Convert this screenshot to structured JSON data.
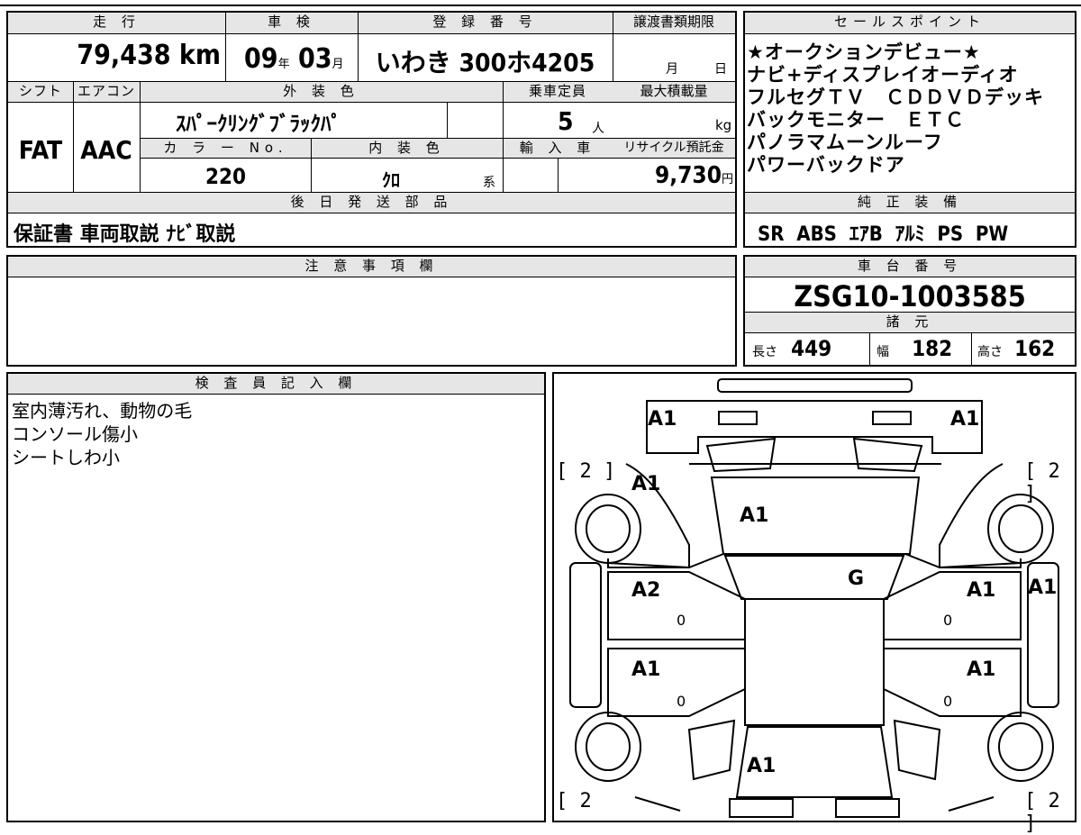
{
  "vehicle": {
    "mileage_label": "走 行",
    "mileage_value": "79,438",
    "mileage_unit": "km",
    "inspection_label": "車 検",
    "inspection_year": "09",
    "inspection_year_unit": "年",
    "inspection_month": "03",
    "inspection_month_unit": "月",
    "registration_label": "登 録 番 号",
    "registration_value": "いわき 300ホ4205",
    "transfer_label": "譲渡書類期限",
    "transfer_month_unit": "月",
    "transfer_day_unit": "日",
    "shift_label": "シフト",
    "shift_value": "FAT",
    "ac_label": "エアコン",
    "ac_value": "AAC",
    "exterior_label": "外 装 色",
    "exterior_value": "ｽﾊﾟｰｸﾘﾝｸﾞﾌﾞﾗｯｸﾊﾟ",
    "capacity_label": "乗車定員",
    "capacity_value": "5",
    "capacity_unit": "人",
    "load_label": "最大積載量",
    "load_unit": "kg",
    "color_no_label": "カ ラ ー No.",
    "color_no_value": "220",
    "interior_label": "内 装 色",
    "interior_value": "ｸﾛ",
    "interior_unit": "系",
    "import_label": "輸 入 車",
    "recycle_label": "リサイクル預託金",
    "recycle_value": "9,730",
    "recycle_unit": "円",
    "later_parts_label": "後 日 発 送 部 品",
    "later_parts_value": "保証書 車両取説 ﾅﾋﾞ取説",
    "notes_label": "注 意 事 項 欄"
  },
  "sales_points": {
    "label": "セールスポイント",
    "lines": [
      "★オークションデビュー★",
      "ナビ+ディスプレイオーディオ",
      "フルセグＴＶ　ＣＤＤＶＤデッキ",
      "バックモニター　ＥＴＣ",
      "パノラマムーンルーフ",
      "パワーバックドア"
    ]
  },
  "genuine_equipment": {
    "label": "純 正 装 備",
    "value": "SR  ABS  ｴｱB  ｱﾙﾐ  PS  PW"
  },
  "chassis": {
    "label": "車 台 番 号",
    "value": "ZSG10-1003585",
    "specs_label": "諸 元",
    "length_label": "長さ",
    "length_value": "449",
    "width_label": "幅",
    "width_value": "182",
    "height_label": "高さ",
    "height_value": "162"
  },
  "inspector": {
    "label": "検 査 員 記 入 欄",
    "lines": [
      "室内薄汚れ、動物の毛",
      "コンソール傷小",
      "シートしわ小"
    ]
  },
  "damage_map": {
    "front_left": "A1",
    "front_right": "A1",
    "hood_left": "A1",
    "hood_center": "A1",
    "windshield": "G",
    "front_door_left": "A2",
    "front_door_right": "A1",
    "pillar_right": "A1",
    "rear_door_left": "A1",
    "rear_door_right": "A1",
    "rear": "A1",
    "zero_marks": [
      "0",
      "0",
      "0",
      "0"
    ],
    "tire_tl": "[ 2 ]",
    "tire_tr": "[ 2 ]",
    "tire_bl": "[ 2",
    "tire_br": "[ 2 ]"
  }
}
